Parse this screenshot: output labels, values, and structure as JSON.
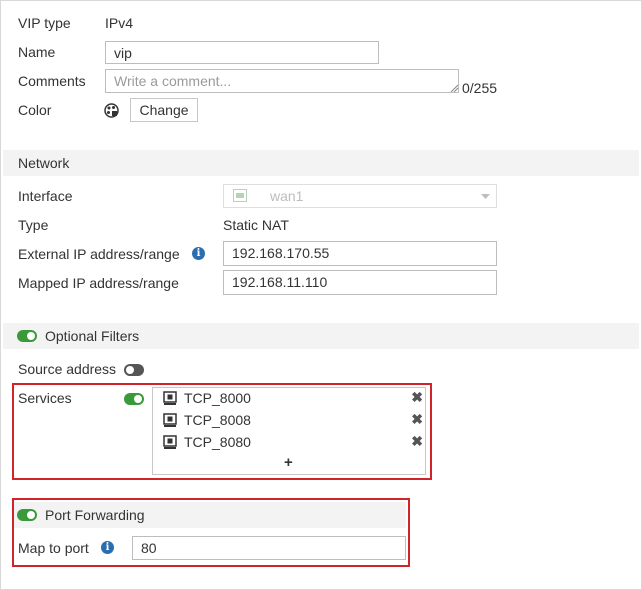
{
  "vip": {
    "type_label": "VIP type",
    "type_value": "IPv4",
    "name_label": "Name",
    "name_value": "vip",
    "comments_label": "Comments",
    "comments_placeholder": "Write a comment...",
    "comments_counter": "0/255",
    "color_label": "Color",
    "change_button": "Change"
  },
  "network": {
    "section_title": "Network",
    "interface_label": "Interface",
    "interface_value": "wan1",
    "type_label": "Type",
    "type_value": "Static NAT",
    "external_label": "External IP address/range",
    "external_value": "192.168.170.55",
    "mapped_label": "Mapped IP address/range",
    "mapped_value": "192.168.11.110"
  },
  "filters": {
    "section_title": "Optional Filters",
    "enabled": true,
    "source_label": "Source address",
    "source_enabled": false,
    "services_label": "Services",
    "services_enabled": true,
    "services": [
      "TCP_8000",
      "TCP_8008",
      "TCP_8080"
    ],
    "add_symbol": "+"
  },
  "port_forwarding": {
    "section_title": "Port Forwarding",
    "enabled": true,
    "map_label": "Map to port",
    "map_value": "80"
  },
  "colors": {
    "toggle_on": "#3a9a3a",
    "highlight": "#d0232a",
    "info": "#2a6eb0"
  }
}
